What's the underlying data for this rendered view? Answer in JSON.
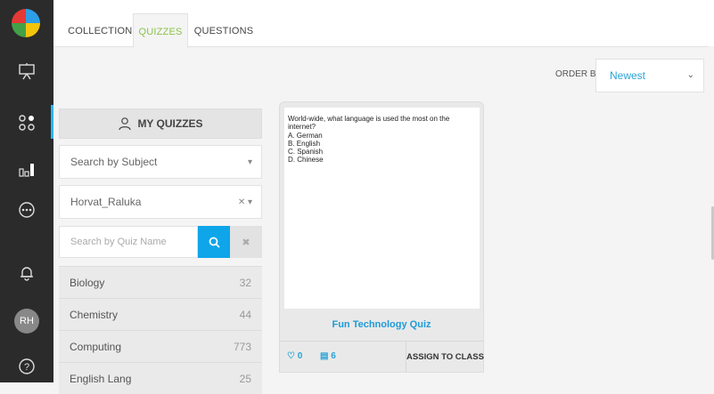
{
  "tabs": [
    {
      "label": "COLLECTIONS"
    },
    {
      "label": "QUIZZES"
    },
    {
      "label": "QUESTIONS"
    }
  ],
  "order_by": {
    "label": "ORDER BY:",
    "value": "Newest"
  },
  "my_quizzes": {
    "label": "MY QUIZZES"
  },
  "filters": {
    "subject": "Search by Subject",
    "user": "Horvat_Raluka",
    "search_placeholder": "Search by Quiz Name"
  },
  "subjects": [
    {
      "name": "Biology",
      "count": "32"
    },
    {
      "name": "Chemistry",
      "count": "44"
    },
    {
      "name": "Computing",
      "count": "773"
    },
    {
      "name": "English Lang",
      "count": "25"
    }
  ],
  "quiz_card": {
    "question": "World-wide, what language is used the most on the internet?",
    "options": [
      "A. German",
      "B. English",
      "C. Spanish",
      "D. Chinese"
    ],
    "title": "Fun Technology Quiz",
    "likes": "0",
    "questions": "6",
    "assign": "ASSIGN TO CLASS"
  },
  "user": {
    "initials": "RH"
  },
  "colors": {
    "accent": "#8bc34a",
    "blue": "#29a3d6",
    "rail": "#2b2b2b"
  }
}
